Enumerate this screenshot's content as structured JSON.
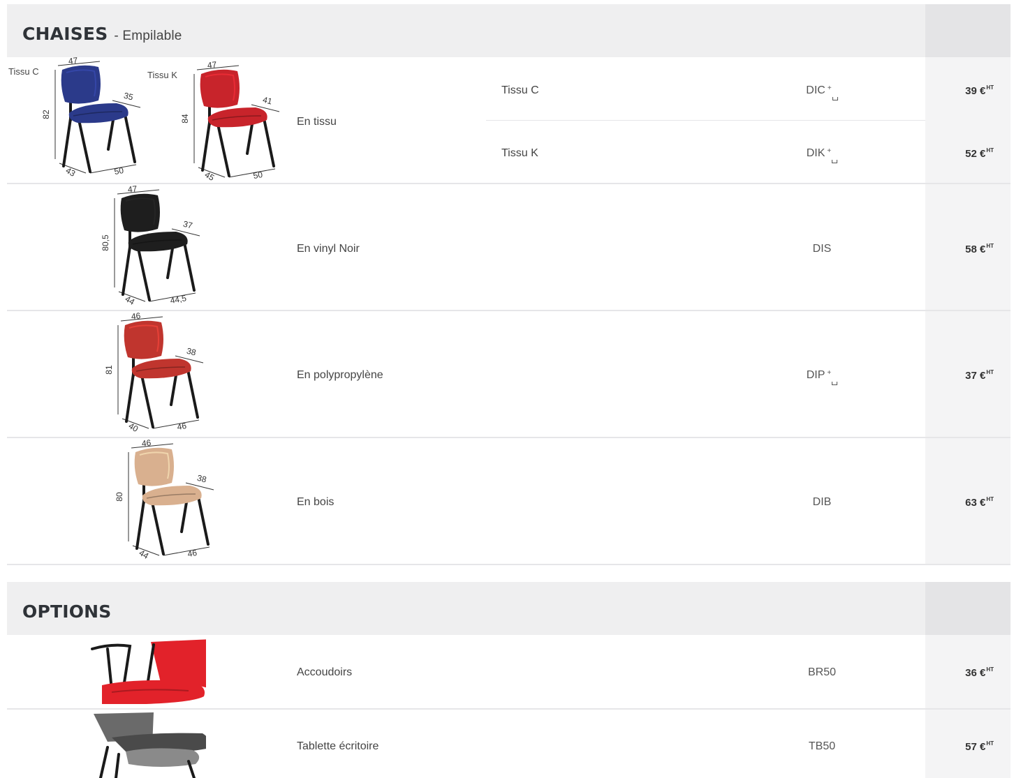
{
  "chaises": {
    "title": "CHAISES",
    "subtitle": "- Empilable",
    "rows": [
      {
        "label": "En tissu",
        "variants": [
          {
            "name": "Tissu C",
            "ref": "DIC",
            "price": "39 €",
            "sup": "HT",
            "color": "#2b3a8a",
            "dims": {
              "w": "47",
              "h": "82",
              "d": "35",
              "b1": "43",
              "b2": "50"
            }
          },
          {
            "name": "Tissu K",
            "ref": "DIK",
            "price": "52 €",
            "sup": "HT",
            "color": "#c8242b",
            "dims": {
              "w": "47",
              "h": "84",
              "d": "41",
              "b1": "45",
              "b2": "50"
            }
          }
        ]
      },
      {
        "label": "En vinyl Noir",
        "ref": "DIS",
        "price": "58 €",
        "sup": "HT",
        "color": "#1e1e1e",
        "dims": {
          "w": "47",
          "h": "80,5",
          "d": "37",
          "b1": "44",
          "b2": "44,5"
        }
      },
      {
        "label": "En polypropylène",
        "ref": "DIP",
        "price": "37 €",
        "sup": "HT",
        "color": "#c0352e",
        "dims": {
          "w": "46",
          "h": "81",
          "d": "38",
          "b1": "40",
          "b2": "46"
        }
      },
      {
        "label": "En bois",
        "ref": "DIB",
        "price": "63 €",
        "sup": "HT",
        "color": "#d9b08f",
        "dims": {
          "w": "46",
          "h": "80",
          "d": "38",
          "b1": "44",
          "b2": "46"
        }
      }
    ]
  },
  "options": {
    "title": "OPTIONS",
    "rows": [
      {
        "label": "Accoudoirs",
        "ref": "BR50",
        "price": "36 €",
        "sup": "HT",
        "color": "#e2222a"
      },
      {
        "label": "Tablette écritoire",
        "ref": "TB50",
        "price": "57 €",
        "sup": "HT",
        "color": "#6a6a6a"
      }
    ]
  },
  "ref_plus_symbol": "+"
}
